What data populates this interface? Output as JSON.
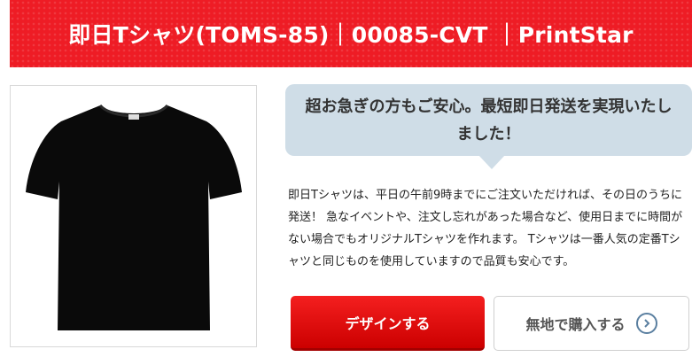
{
  "header": {
    "title": "即日Tシャツ(TOMS-85)｜00085-CVT ｜PrintStar",
    "bg_color": "#ee1c25"
  },
  "product": {
    "image_icon": "black-tshirt-icon",
    "shirt_color": "#0a0a0a"
  },
  "callout": {
    "text": "超お急ぎの方もご安心。最短即日発送を実現いたしました！",
    "bg_color": "#cfdde7"
  },
  "description": "即日Tシャツは、平日の午前9時までにご注文いただければ、その日のうちに発送！ 急なイベントや、注文し忘れがあった場合など、使用日までに時間がない場合でもオリジナルTシャツを作れます。 Tシャツは一番人気の定番Tシャツと同じものを使用していますので品質も安心です。",
  "buttons": {
    "design_label": "デザインする",
    "design_color": "#e60012",
    "plain_label": "無地で購入する",
    "plain_icon": "chevron-right-circle-icon"
  }
}
